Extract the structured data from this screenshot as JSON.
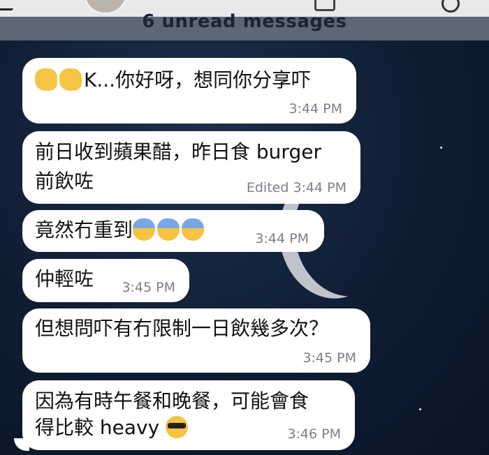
{
  "header": {
    "unread_label": "6 unread messages"
  },
  "messages": [
    {
      "text": "K...你好呀，想同你分享吓",
      "time": "3:44 PM",
      "emoji_prefix": [
        "waving-hand",
        "waving-hand"
      ]
    },
    {
      "text_line1": "前日收到蘋果醋，昨日食 burger",
      "text_line2": "前飲咗",
      "status": "Edited",
      "time": "3:44 PM"
    },
    {
      "text": "竟然冇重到",
      "emoji_suffix": [
        "face-screaming-in-fear",
        "face-screaming-in-fear",
        "face-screaming-in-fear"
      ],
      "time": "3:44 PM"
    },
    {
      "text": "仲輕咗",
      "time": "3:45 PM"
    },
    {
      "text": "但想問吓有冇限制一日飲幾多次？",
      "time": "3:45 PM"
    },
    {
      "text_line1": "因為有時午餐和晚餐，可能會食",
      "text_line2": "得比較 heavy",
      "emoji_suffix": [
        "smiling-face-with-sunglasses"
      ],
      "time": "3:46 PM"
    }
  ],
  "colors": {
    "bubble": "#ffffff",
    "background": "#0f1d33",
    "timestamp": "#7c7f86"
  }
}
